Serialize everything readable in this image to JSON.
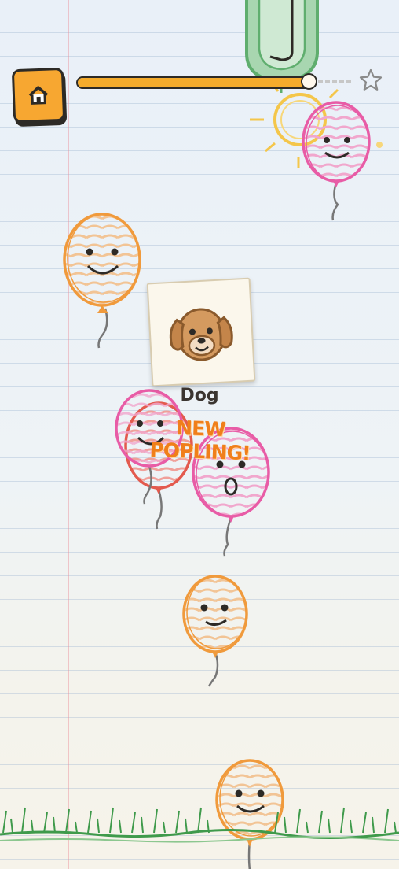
{
  "game": {
    "progress_fraction": 0.96,
    "goal_icon": "star-outline-icon",
    "home_icon": "home-icon"
  },
  "popling": {
    "name": "Dog",
    "banner": "NEW POPLING!",
    "icon": "dog-face-icon"
  },
  "balloons": [
    {
      "color": "orange",
      "face": "smile"
    },
    {
      "color": "pink",
      "face": "smile"
    },
    {
      "color": "pink",
      "face": "smile"
    },
    {
      "color": "red",
      "face": "smile"
    },
    {
      "color": "pink",
      "face": "surprised"
    },
    {
      "color": "orange",
      "face": "neutral"
    },
    {
      "color": "orange",
      "face": "smile"
    }
  ],
  "colors": {
    "orange": "#f09a3c",
    "pink": "#e85ca6",
    "red": "#e35a4e",
    "accent": "#f5ab2c",
    "needle_green": "#5fae6e",
    "grass": "#3f9a4b"
  }
}
